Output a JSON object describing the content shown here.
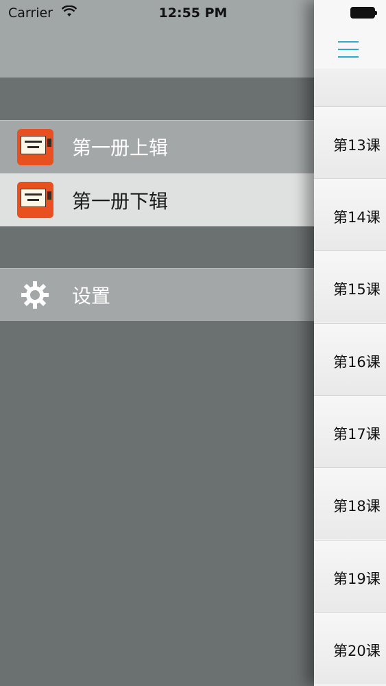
{
  "status_bar": {
    "carrier": "Carrier",
    "time": "12:55 PM"
  },
  "drawer": {
    "items": [
      {
        "label": "第一册上辑",
        "icon": "book-icon"
      },
      {
        "label": "第一册下辑",
        "icon": "book-icon"
      },
      {
        "label": "设置",
        "icon": "gear-icon"
      }
    ]
  },
  "content": {
    "menu_icon": "hamburger-menu-icon",
    "accent_color": "#2aa9d6",
    "lessons": [
      "第13课",
      "第14课",
      "第15课",
      "第16课",
      "第17课",
      "第18课",
      "第19课",
      "第20课"
    ]
  }
}
